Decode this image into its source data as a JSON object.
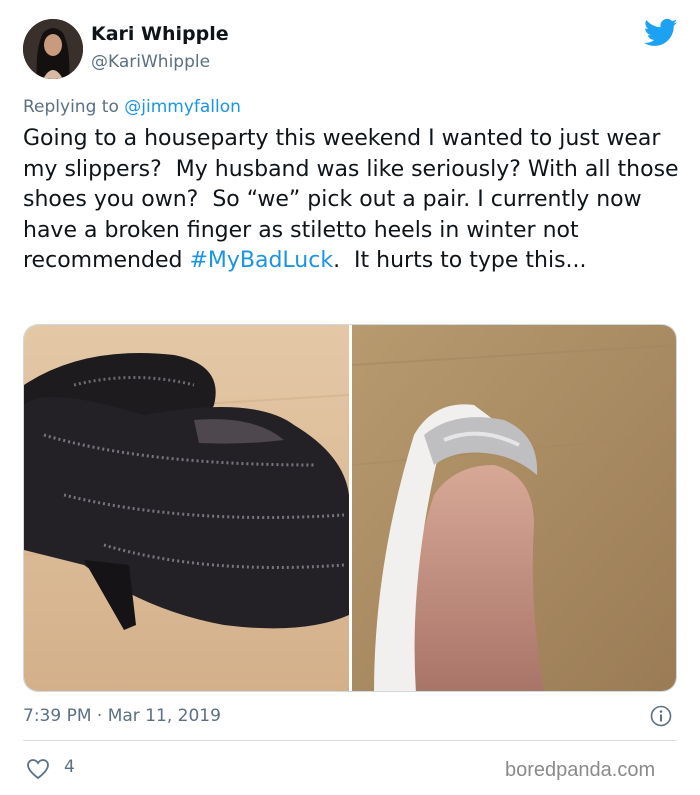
{
  "user": {
    "name": "Kari Whipple",
    "handle": "@KariWhipple"
  },
  "reply": {
    "prefix": "Replying to ",
    "mention": "@jimmyfallon"
  },
  "tweet": {
    "text_main": "Going to a houseparty this weekend I wanted to just wear my slippers?  My husband was like seriously? With all those shoes you own?  So “we” pick out a pair. I currently now have a broken finger as stiletto heels in winter not recommended ",
    "hashtag": "#MyBadLuck",
    "text_end": ".  It hurts to type this..."
  },
  "meta": {
    "timestamp": "7:39 PM · Mar 11, 2019",
    "likes": "4"
  },
  "watermark": "boredpanda.com",
  "icons": {
    "brand": "twitter-bird-icon",
    "info": "info-icon",
    "like": "heart-icon"
  },
  "colors": {
    "link": "#1b95e0",
    "secondary_text": "#5b7083",
    "twitter_blue": "#1da1f2"
  }
}
